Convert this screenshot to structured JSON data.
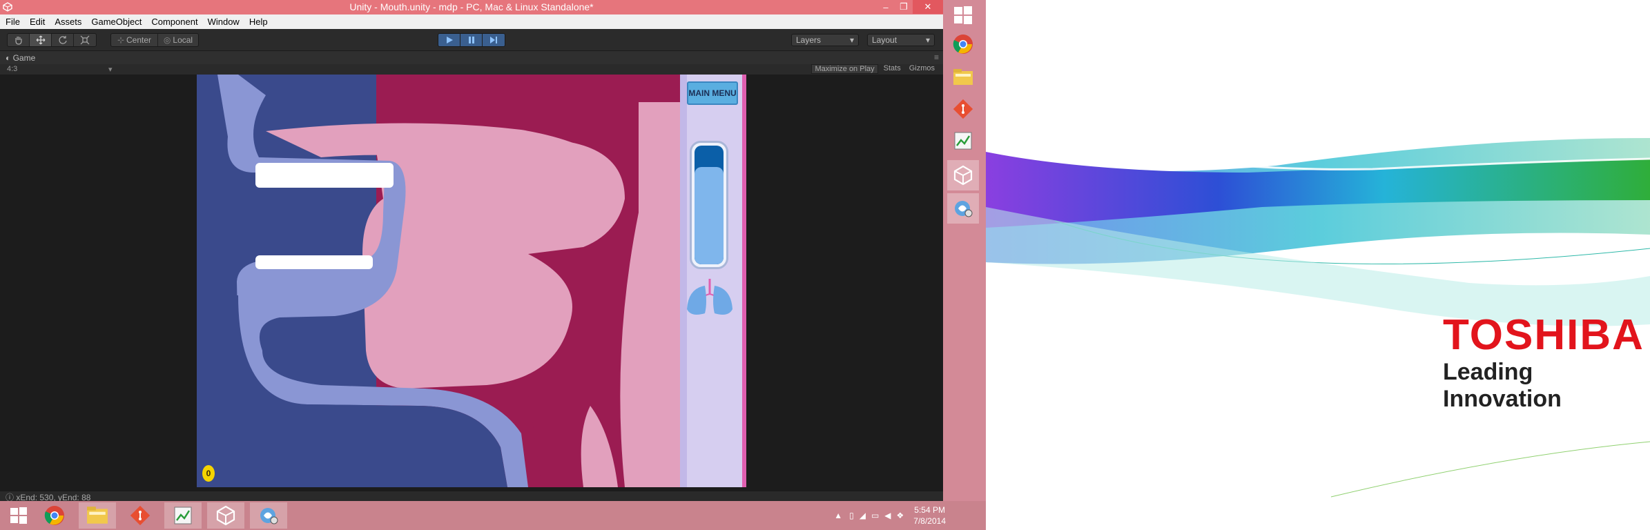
{
  "window": {
    "title": "Unity - Mouth.unity - mdp - PC, Mac & Linux Standalone*",
    "minimize": "–",
    "restore": "❐",
    "close": "✕"
  },
  "menu": [
    "File",
    "Edit",
    "Assets",
    "GameObject",
    "Component",
    "Window",
    "Help"
  ],
  "toolbar": {
    "pivot_mode": "Center",
    "pivot_rotation": "Local",
    "layers_label": "Layers",
    "layout_label": "Layout"
  },
  "game_tab": {
    "label": "Game",
    "aspect": "4:3",
    "maximize_on_play": "Maximize on Play",
    "stats": "Stats",
    "gizmos": "Gizmos"
  },
  "game": {
    "main_menu_label": "MAIN MENU",
    "breath_level": 0.82,
    "score": "0"
  },
  "status": {
    "text": "xEnd: 530, yEnd: 88"
  },
  "desktop": {
    "brand": "TOSHIBA",
    "tagline": "Leading Innovation"
  },
  "taskbar": {
    "clock_time": "5:54 PM",
    "clock_date": "7/8/2014"
  },
  "colors": {
    "titlebar": "#e6757c",
    "game_dark_blue": "#3a4a8c",
    "game_tissue_pink": "#e2a0bd",
    "game_magenta": "#9b1c52",
    "game_pale_blue": "#8a96d4",
    "brand_red": "#e2141c"
  }
}
